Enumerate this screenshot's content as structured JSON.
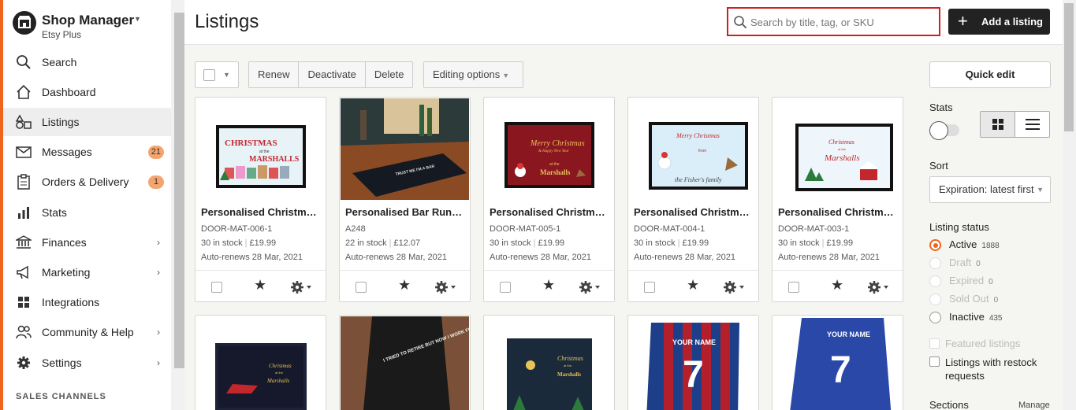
{
  "shop": {
    "name": "Shop Manager",
    "plan": "Etsy Plus"
  },
  "nav": [
    {
      "label": "Search",
      "icon": "search-icon"
    },
    {
      "label": "Dashboard",
      "icon": "home-icon"
    },
    {
      "label": "Listings",
      "icon": "listings-icon",
      "active": true
    },
    {
      "label": "Messages",
      "icon": "envelope-icon",
      "badge": "21"
    },
    {
      "label": "Orders & Delivery",
      "icon": "clipboard-icon",
      "badge": "1"
    },
    {
      "label": "Stats",
      "icon": "bar-chart-icon"
    },
    {
      "label": "Finances",
      "icon": "bank-icon",
      "arrow": true
    },
    {
      "label": "Marketing",
      "icon": "megaphone-icon",
      "arrow": true
    },
    {
      "label": "Integrations",
      "icon": "grid-icon"
    },
    {
      "label": "Community & Help",
      "icon": "people-icon",
      "arrow": true
    },
    {
      "label": "Settings",
      "icon": "gear-icon",
      "arrow": true
    }
  ],
  "sales_channels": "SALES CHANNELS",
  "header": {
    "title": "Listings",
    "search_placeholder": "Search by title, tag, or SKU",
    "add_label": "Add a listing"
  },
  "toolbar": {
    "renew": "Renew",
    "deactivate": "Deactivate",
    "delete": "Delete",
    "editing_options": "Editing options"
  },
  "listings": [
    {
      "title": "Personalised Christmas Door Mat",
      "sku": "DOOR-MAT-006-1",
      "stock": "30 in stock",
      "price": "£19.99",
      "renews": "Auto-renews 28 Mar, 2021"
    },
    {
      "title": "Personalised Bar Runner",
      "sku": "A248",
      "stock": "22 in stock",
      "price": "£12.07",
      "renews": "Auto-renews 28 Mar, 2021"
    },
    {
      "title": "Personalised Christmas Door Mat",
      "sku": "DOOR-MAT-005-1",
      "stock": "30 in stock",
      "price": "£19.99",
      "renews": "Auto-renews 28 Mar, 2021"
    },
    {
      "title": "Personalised Christmas Door Mat",
      "sku": "DOOR-MAT-004-1",
      "stock": "30 in stock",
      "price": "£19.99",
      "renews": "Auto-renews 28 Mar, 2021"
    },
    {
      "title": "Personalised Christmas Door Mat",
      "sku": "DOOR-MAT-003-1",
      "stock": "30 in stock",
      "price": "£19.99",
      "renews": "Auto-renews 28 Mar, 2021"
    }
  ],
  "image_text": {
    "mat1_title": "CHRISTMAS",
    "mat1_sub": "at the",
    "mat1_name": "MARSHALLS",
    "bar_text": "TRUST ME I'M A BAR",
    "mat3_title": "Merry Christmas",
    "mat3_sub": "& Happy New Year",
    "mat3_at": "at the",
    "mat3_name": "Marshalls",
    "mat4_title": "Merry Christmas",
    "mat4_from": "from",
    "mat4_name": "the Fisher's family",
    "mat5_title": "Christmas",
    "mat5_at": "at the",
    "mat5_name": "Marshalls",
    "mat6_title": "Christmas",
    "mat6_at": "at the",
    "mat6_name": "Marshalls",
    "apron_text": "I TRIED TO RETIRE BUT NOW I WORK FOR MY WIFE",
    "mat8_title": "Christmas",
    "mat8_at": "at the",
    "mat8_name": "Marshalls",
    "towel_name": "YOUR NAME",
    "towel_number": "7"
  },
  "right_panel": {
    "quick_edit": "Quick edit",
    "stats_label": "Stats",
    "sort_label": "Sort",
    "sort_value": "Expiration: latest first",
    "status_label": "Listing status",
    "statuses": [
      {
        "name": "Active",
        "count": "1888",
        "selected": true,
        "dim": false
      },
      {
        "name": "Draft",
        "count": "0",
        "selected": false,
        "dim": true
      },
      {
        "name": "Expired",
        "count": "0",
        "selected": false,
        "dim": true
      },
      {
        "name": "Sold Out",
        "count": "0",
        "selected": false,
        "dim": true
      },
      {
        "name": "Inactive",
        "count": "435",
        "selected": false,
        "dim": false
      }
    ],
    "featured": "Featured listings",
    "restock": "Listings with restock requests",
    "sections": "Sections",
    "manage": "Manage"
  },
  "colors": {
    "accent": "#f1641e",
    "search_border": "#d11f1f",
    "dark_button": "#222222"
  }
}
